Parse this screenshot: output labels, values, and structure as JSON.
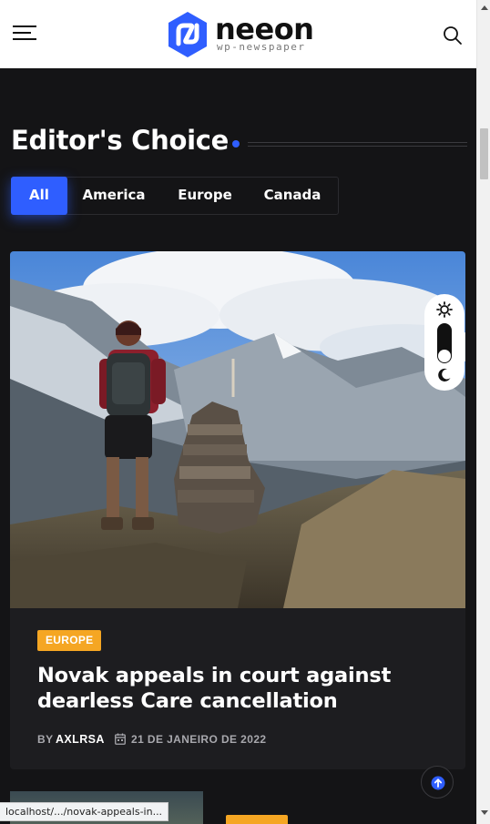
{
  "header": {
    "logo_name": "neeon",
    "logo_subtitle": "wp-newspaper",
    "menu_icon": "hamburger-menu-icon",
    "search_icon": "search-icon"
  },
  "section": {
    "title": "Editor's Choice"
  },
  "tabs": [
    {
      "label": "All",
      "active": true
    },
    {
      "label": "America",
      "active": false
    },
    {
      "label": "Europe",
      "active": false
    },
    {
      "label": "Canada",
      "active": false
    }
  ],
  "featured_post": {
    "category": "EUROPE",
    "title": "Novak appeals in court against dearless Care cancellation",
    "by_label": "BY",
    "author": "AXLRSA",
    "date": "21 DE JANEIRO DE 2022"
  },
  "theme_toggle": {
    "sun_icon": "sun-icon",
    "moon_icon": "moon-icon",
    "mode": "dark"
  },
  "status_bar": {
    "url": "localhost/.../novak-appeals-in..."
  },
  "colors": {
    "accent": "#2f5eff",
    "badge": "#f5a623",
    "page_background": "#141416",
    "card_background": "#1d1d20"
  }
}
